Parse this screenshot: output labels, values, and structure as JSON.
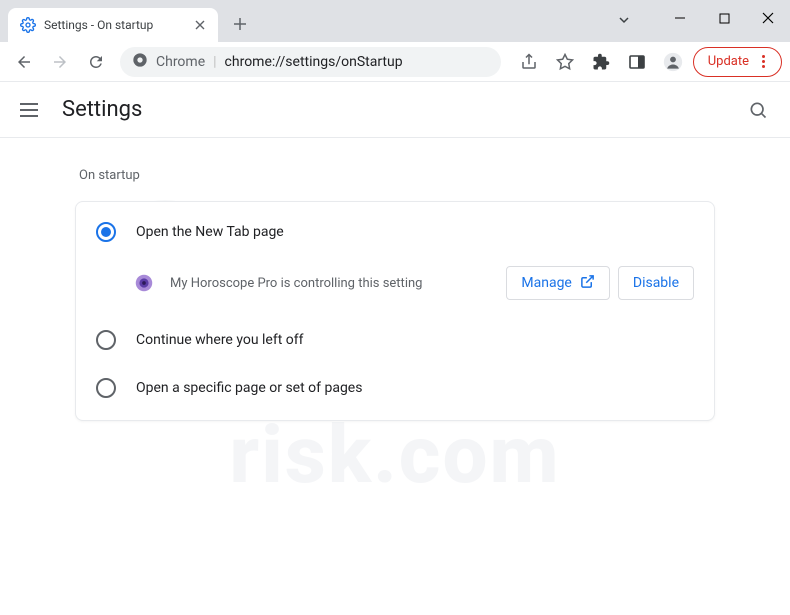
{
  "window": {
    "tab_title": "Settings - On startup"
  },
  "toolbar": {
    "origin": "Chrome",
    "path": "chrome://settings/onStartup",
    "update_label": "Update"
  },
  "header": {
    "title": "Settings"
  },
  "section": {
    "label": "On startup"
  },
  "options": {
    "opt1": "Open the New Tab page",
    "opt2": "Continue where you left off",
    "opt3": "Open a specific page or set of pages"
  },
  "extension": {
    "message": "My Horoscope Pro is controlling this setting",
    "manage_label": "Manage",
    "disable_label": "Disable"
  }
}
